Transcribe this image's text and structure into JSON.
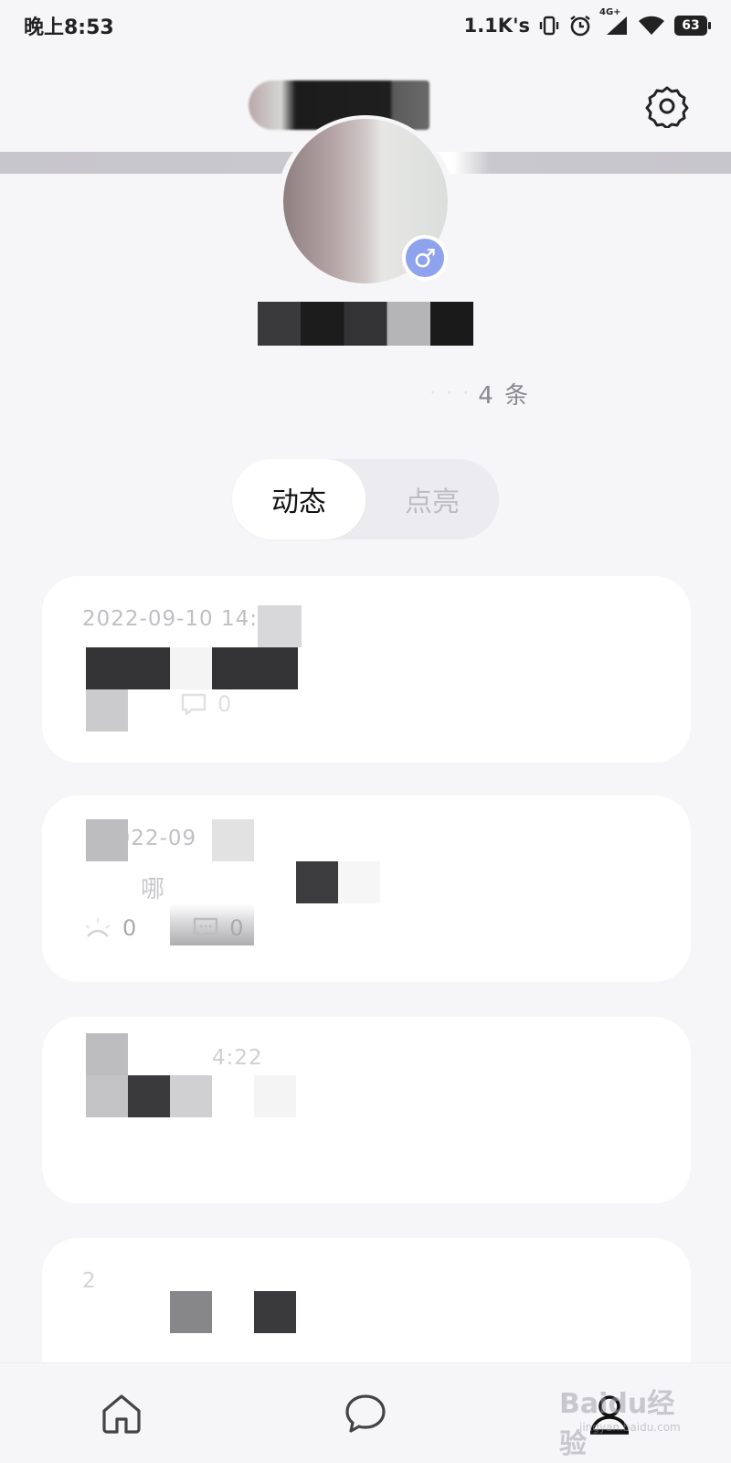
{
  "status_bar": {
    "time": "晚上8:53",
    "network_speed": "1.1K's",
    "network_type": "4G+",
    "battery": "63",
    "icons": [
      "vibrate-icon",
      "alarm-icon",
      "signal-icon",
      "wifi-icon",
      "battery-icon"
    ]
  },
  "header": {
    "settings_icon": "gear-icon"
  },
  "profile": {
    "gender_symbol": "♂",
    "post_count": "4 条"
  },
  "tabs": [
    {
      "label": "动态",
      "active": true
    },
    {
      "label": "点亮",
      "active": false
    }
  ],
  "feed": [
    {
      "time": "2022-09-10 14:25",
      "text": "",
      "likes": "",
      "comments": "0"
    },
    {
      "time": "2022-09",
      "text": "哪",
      "likes": "0",
      "comments": "0"
    },
    {
      "time": "4:22",
      "text": "",
      "likes": "",
      "comments": ""
    },
    {
      "time": "2",
      "text": "",
      "likes": "",
      "comments": ""
    }
  ],
  "bottom_nav": [
    {
      "name": "home",
      "icon": "home-icon"
    },
    {
      "name": "messages",
      "icon": "chat-bubble-icon"
    },
    {
      "name": "profile",
      "icon": "user-icon",
      "active": true
    }
  ],
  "watermark": {
    "brand": "Baidu经验",
    "url": "jingyan.baidu.com"
  },
  "colors": {
    "background": "#f6f6f8",
    "card": "#ffffff",
    "gender_badge": "#8fa2ee",
    "muted_text": "#c0c0c4"
  }
}
